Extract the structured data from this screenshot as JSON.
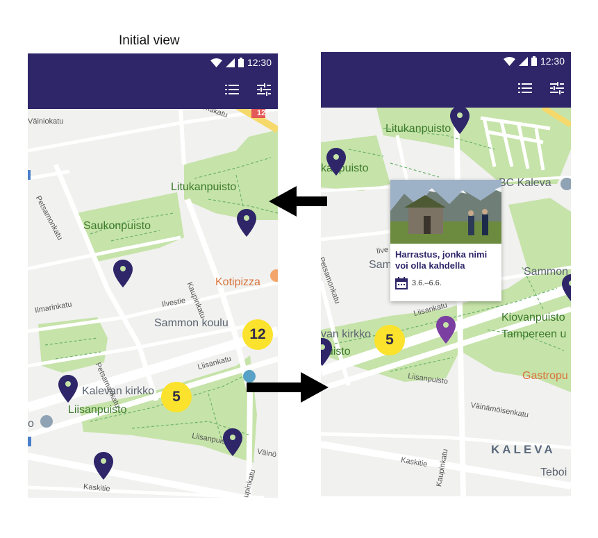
{
  "caption": "Initial view",
  "status_bar": {
    "time": "12:30"
  },
  "appbar": {
    "color": "#2e2669",
    "list_icon": "list-icon",
    "filter_icon": "tune-icon"
  },
  "left": {
    "labels": {
      "litukanpuisto": "Litukanpuisto",
      "saukonpuisto": "Saukonpuisto",
      "kotipizza": "Kotipizza",
      "sammon_koulu": "Sammon koulu",
      "kalevan_kirkko": "Kalevan kirkko",
      "liisanpuisto": "Liisanpuisto",
      "omakatu": "Omakatu",
      "vainiokatu": "Väiniokatu",
      "petsamonkatu": "Petsamonkatu",
      "petsamonkatu2": "Petsamonkatu",
      "kaupinkatu": "Kaupinkatu",
      "kaupinkatu2": "Kaupinkatu",
      "ilvestie": "Ilvestie",
      "ilmarinkatu": "Ilmarinkatu",
      "liisankatu": "Liisankatu",
      "liisanpuisto_road": "Liisanpuisto",
      "vaino": "Väinö",
      "kaskitie": "Kaskitie",
      "road_badge": "12",
      "edge_o": "o"
    },
    "clusters": {
      "big": "12",
      "small": "5"
    }
  },
  "right": {
    "labels": {
      "litukanpuisto": "Litukanpuisto",
      "kapuisto": "kanpuisto",
      "bc_kaleva": "BC Kaleva",
      "sammon": "Sammon",
      "sam": "Sam",
      "kiovanpuisto": "Kiovanpuisto",
      "tampereen": "Tampereen u",
      "vankirkko": "van kirkko",
      "puisto": "puisto",
      "gastropub": "Gastropu",
      "kaleva": "KALEVA",
      "teboi": "Teboi",
      "liisankatu": "Liisankatu",
      "liisanpuisto_road": "Liisanpuisto",
      "vainamoisenkatu": "Väinämöisenkatu",
      "kaupinkatu": "Kaupinkatu",
      "kaskitie": "Kaskitie",
      "petsamonkatu": "Petsamonkatu",
      "ilve": "Ilve"
    },
    "clusters": {
      "small": "5"
    },
    "popup": {
      "title": "Harrastus, jonka nimi voi olla kahdella",
      "date": "3.6.–6.6.",
      "date_icon": "calendar-icon"
    }
  },
  "colors": {
    "pin": "#2e2669",
    "pin_selected": "#7a3fa0",
    "park": "#c6e3a9",
    "cluster": "#fbe22c"
  }
}
